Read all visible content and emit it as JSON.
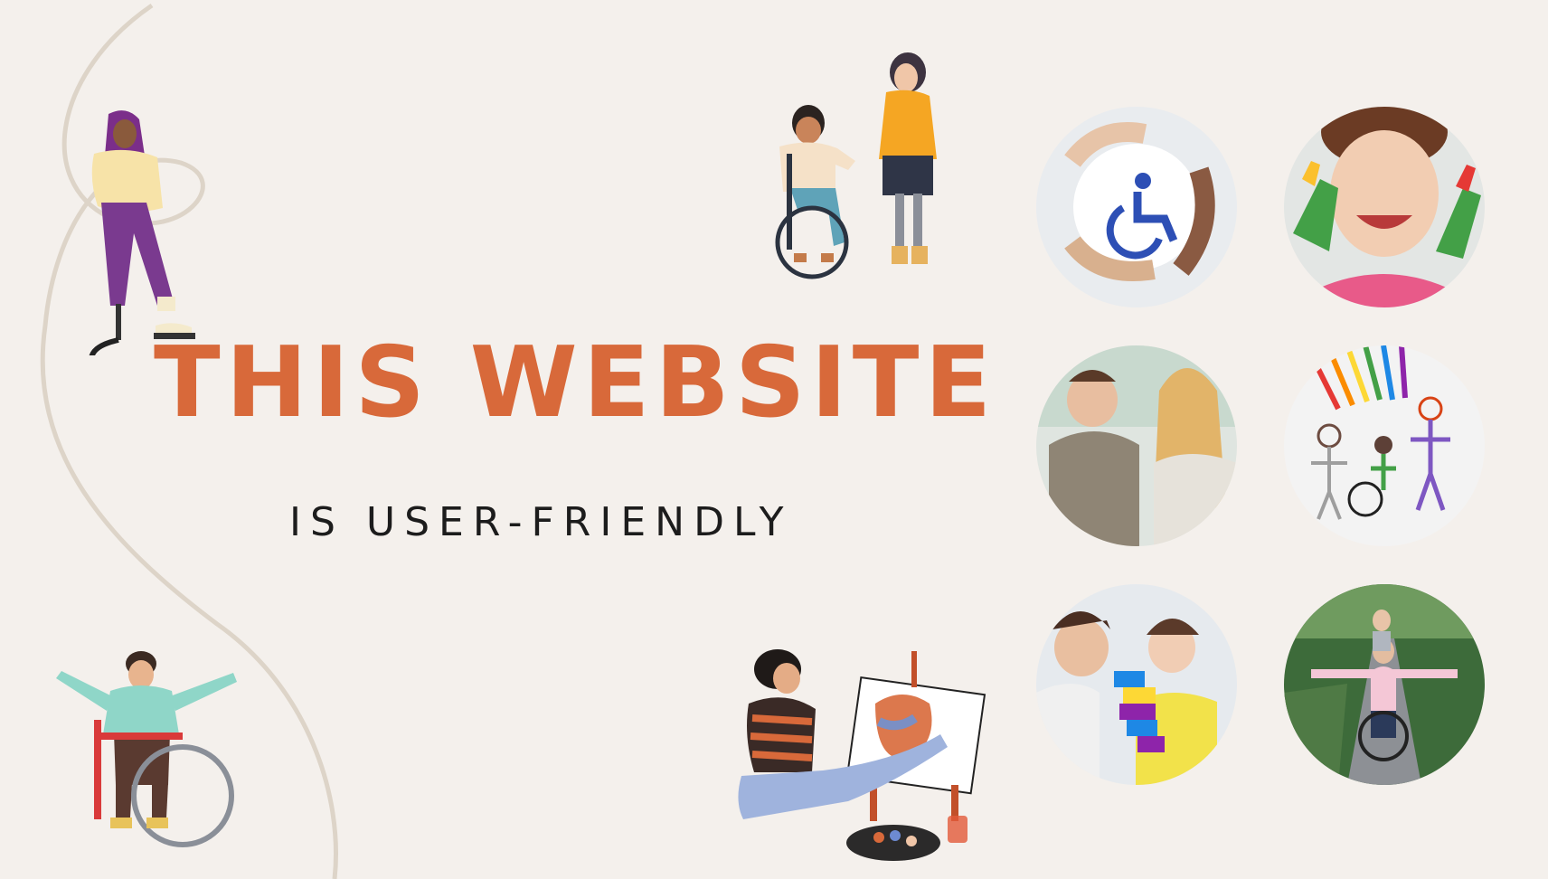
{
  "slide": {
    "title": "THIS WEBSITE",
    "subtitle": "IS USER-FRIENDLY"
  },
  "colors": {
    "background": "#f4f0ec",
    "accent": "#d8693a",
    "text": "#1c1c1c",
    "curve": "#ddd4c8"
  },
  "illustrations": [
    {
      "name": "woman-with-prosthetic-leg-icon"
    },
    {
      "name": "wheelchair-user-holding-hands-icon"
    },
    {
      "name": "wheelchair-user-arms-raised-icon"
    },
    {
      "name": "woman-painting-on-easel-icon"
    }
  ],
  "photos": [
    {
      "name": "accessibility-hands-symbol-photo"
    },
    {
      "name": "child-painted-hands-photo"
    },
    {
      "name": "boy-wheelchair-with-woman-photo"
    },
    {
      "name": "child-drawing-crayons-photo"
    },
    {
      "name": "girl-building-blocks-photo"
    },
    {
      "name": "man-wheelchair-road-photo"
    }
  ]
}
